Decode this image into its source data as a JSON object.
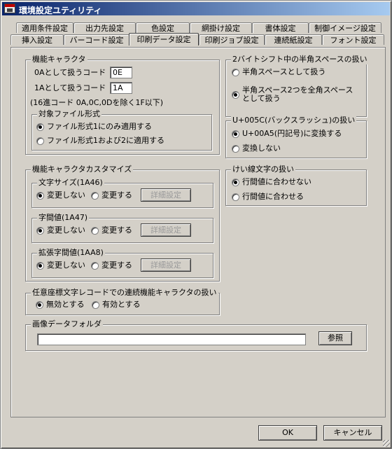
{
  "window": {
    "title": "環境設定ユティリティ"
  },
  "tabs": {
    "row1": [
      "適用条件設定",
      "出力先設定",
      "色設定",
      "網掛け設定",
      "書体設定",
      "制御イメージ設定"
    ],
    "row2": [
      "挿入設定",
      "バーコード設定",
      "印刷データ設定",
      "印刷ジョブ設定",
      "連続紙設定",
      "フォント設定"
    ],
    "active": "印刷データ設定"
  },
  "function_char": {
    "legend": "機能キャラクタ",
    "code0a_label": "0Aとして扱うコード",
    "code0a_value": "0E",
    "code1a_label": "1Aとして扱うコード",
    "code1a_value": "1A",
    "note": "(16進コード 0A,0C,0Dを除く1F以下)",
    "file_format": {
      "legend": "対象ファイル形式",
      "option1": "ファイル形式1にのみ適用する",
      "option2": "ファイル形式1および2に適用する"
    }
  },
  "customize": {
    "legend": "機能キャラクタカスタマイズ",
    "char_size": {
      "legend": "文字サイズ(1A46)",
      "no_change": "変更しない",
      "change": "変更する",
      "detail": "詳細設定"
    },
    "char_spacing": {
      "legend": "字間値(1A47)",
      "no_change": "変更しない",
      "change": "変更する",
      "detail": "詳細設定"
    },
    "ext_spacing": {
      "legend": "拡張字間値(1AA8)",
      "no_change": "変更しない",
      "change": "変更する",
      "detail": "詳細設定"
    }
  },
  "continuous": {
    "legend": "任意座標文字レコードでの連続機能キャラクタの扱い",
    "invalid": "無効とする",
    "valid": "有効とする"
  },
  "shift_space": {
    "legend": "2バイトシフト中の半角スペースの扱い",
    "option1": "半角スペースとして扱う",
    "option2_line1": "半角スペース2つを全角スペース",
    "option2_line2": "として扱う"
  },
  "backslash": {
    "legend": "U+005C(バックスラッシュ)の扱い",
    "option1": "U+00A5(円記号)に変換する",
    "option2": "変換しない"
  },
  "ruled_line": {
    "legend": "けい線文字の扱い",
    "option1": "行間値に合わせない",
    "option2": "行間値に合わせる"
  },
  "image_folder": {
    "legend": "画像データフォルダ",
    "value": "",
    "browse": "参照"
  },
  "footer": {
    "ok": "OK",
    "cancel": "キャンセル"
  }
}
